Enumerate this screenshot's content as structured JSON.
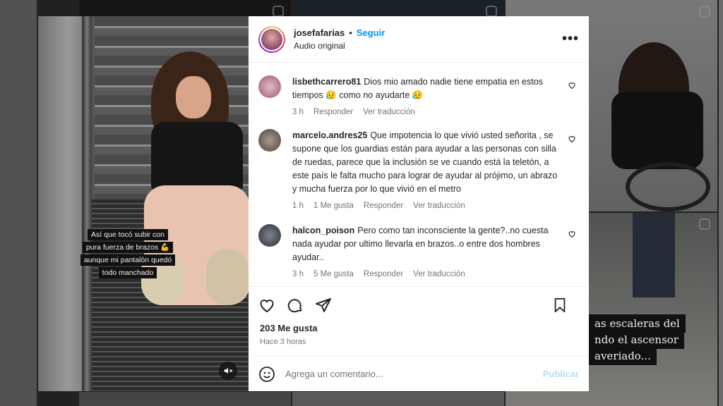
{
  "background": {
    "caption_lines": [
      "as escaleras del",
      "ndo el ascensor",
      "averiado..."
    ]
  },
  "media": {
    "caption_lines": [
      "Así que tocó subir con",
      "pura fuerza de brazos 💪",
      "aunque mi pantalón quedó",
      "todo manchado"
    ],
    "mute_icon": "speaker-muted-icon"
  },
  "header": {
    "username": "josefafarias",
    "separator": "•",
    "follow_label": "Seguir",
    "audio_label": "Audio original",
    "more_label": "•••"
  },
  "comments": [
    {
      "user": "lisbethcarrero81",
      "text": "Dios mio amado nadie tiene empatia en estos tiempos 😥 como no ayudarte 😥",
      "time": "3 h",
      "likes": "",
      "reply": "Responder",
      "translate": "Ver traducción",
      "avatar_color": "#c58aa0"
    },
    {
      "user": "marcelo.andres25",
      "text": "Que impotencia lo que vivió usted señorita , se supone que los guardias están para ayudar a las personas con silla de ruedas, parece que la inclusión se ve cuando está la teletón, a este país le falta mucho para lograr de ayudar al prójimo, un abrazo y mucha fuerza por lo que vivió en el metro",
      "time": "1 h",
      "likes": "1 Me gusta",
      "reply": "Responder",
      "translate": "Ver traducción",
      "avatar_color": "#7a6a60"
    },
    {
      "user": "halcon_poison",
      "text": "Pero como tan inconsciente la gente?..no cuesta nada ayudar por ultimo llevarla en brazos..o entre dos hombres ayudar..",
      "time": "3 h",
      "likes": "5 Me gusta",
      "reply": "Responder",
      "translate": "Ver traducción",
      "avatar_color": "#4b4f55"
    }
  ],
  "stats": {
    "likes": "203 Me gusta",
    "posted": "Hace 3 horas"
  },
  "composer": {
    "placeholder": "Agrega un comentario...",
    "publish_label": "Publicar"
  },
  "colors": {
    "accent": "#0095f6",
    "publish_disabled": "#b2dffc",
    "text": "#262626",
    "muted": "#737373"
  }
}
